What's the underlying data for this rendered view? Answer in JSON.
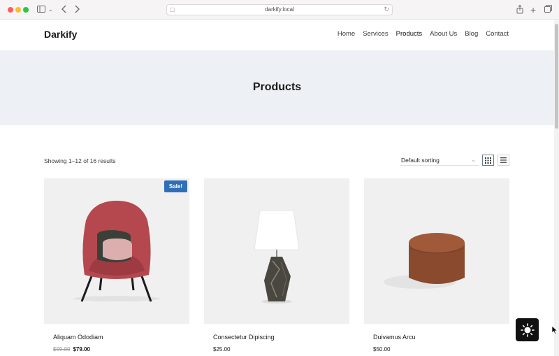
{
  "browser": {
    "url": "darkify.local"
  },
  "site": {
    "logo": "Darkify",
    "nav": [
      {
        "label": "Home",
        "active": false
      },
      {
        "label": "Services",
        "active": false
      },
      {
        "label": "Products",
        "active": true
      },
      {
        "label": "About Us",
        "active": false
      },
      {
        "label": "Blog",
        "active": false
      },
      {
        "label": "Contact",
        "active": false
      }
    ]
  },
  "hero": {
    "title": "Products"
  },
  "toolbar": {
    "result_count": "Showing 1–12 of 16 results",
    "sort_selected": "Default sorting"
  },
  "products": [
    {
      "name": "Aliquam Ododiam",
      "old_price": "$99.00",
      "price": "$79.00",
      "badge": "Sale!",
      "image": "armchair"
    },
    {
      "name": "Consectetur Dipiscing",
      "price": "$25.00",
      "image": "table-lamp"
    },
    {
      "name": "Duivamus Arcu",
      "price": "$50.00",
      "image": "ottoman"
    }
  ],
  "colors": {
    "hero_bg": "#edf1f5",
    "sale_badge": "#2f6fb8",
    "toggle_bg": "#111111"
  },
  "icons": {
    "dark_toggle": "sun-icon"
  }
}
